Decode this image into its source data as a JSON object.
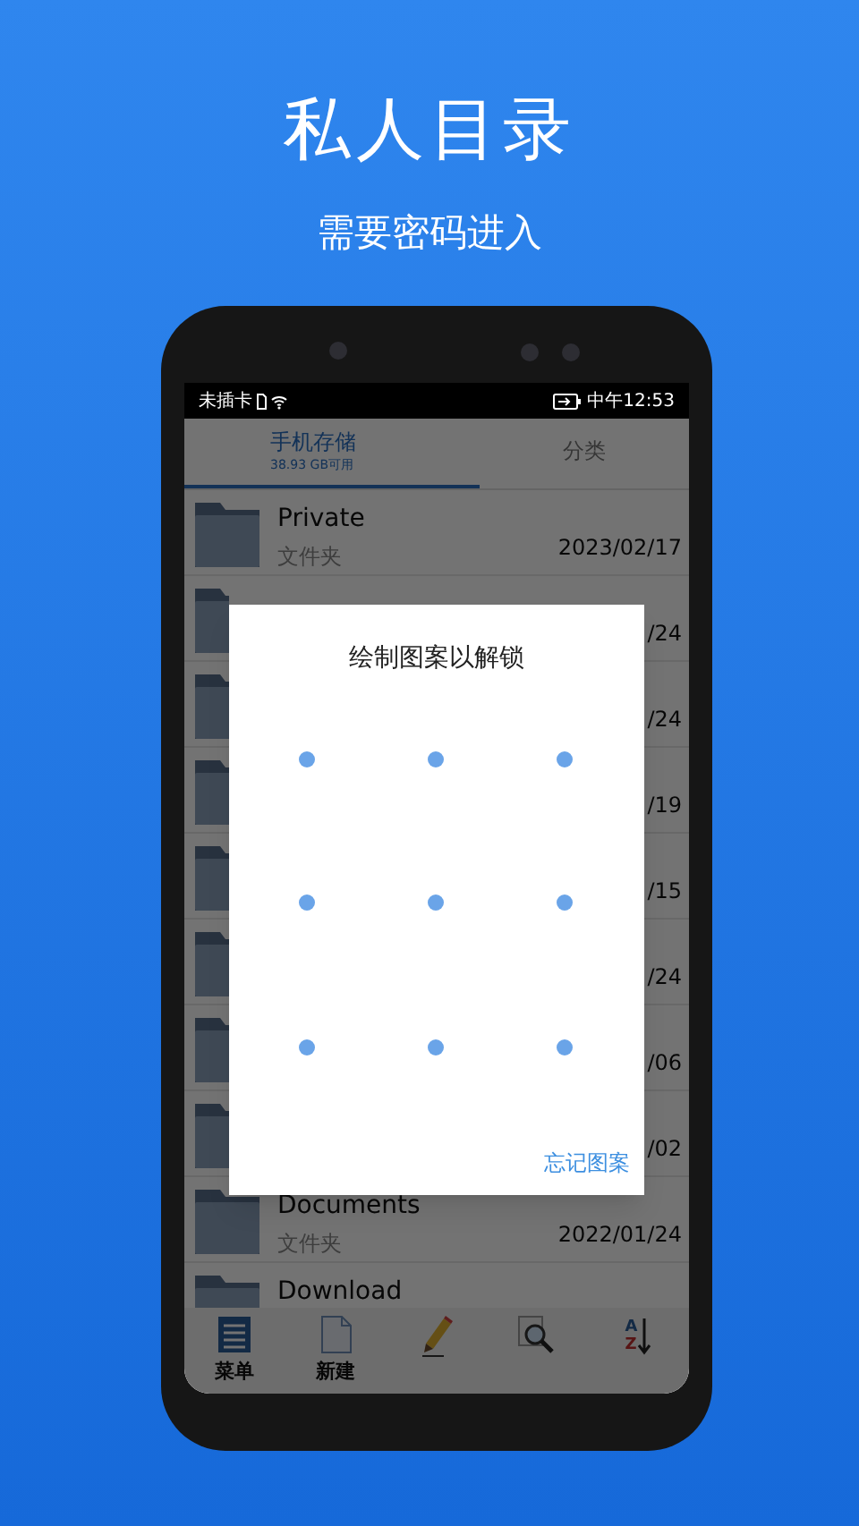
{
  "header": {
    "title": "私人目录",
    "subtitle": "需要密码进入"
  },
  "status_bar": {
    "carrier": "未插卡",
    "time": "中午12:53"
  },
  "tabs": [
    {
      "label": "手机存储",
      "sublabel": "38.93 GB可用",
      "selected": true
    },
    {
      "label": "分类",
      "selected": false
    }
  ],
  "files": [
    {
      "name": "Private",
      "type": "文件夹",
      "date": "2023/02/17"
    },
    {
      "date": "/24"
    },
    {
      "date": "/24"
    },
    {
      "date": "/19"
    },
    {
      "date": "/15"
    },
    {
      "date": "/24"
    },
    {
      "date": "/06"
    },
    {
      "date": "/02"
    },
    {
      "name": "Documents",
      "type": "文件夹",
      "date": "2022/01/24"
    },
    {
      "name": "Download"
    }
  ],
  "toolbar": [
    {
      "kind": "menu",
      "label": "菜单"
    },
    {
      "kind": "new",
      "label": "新建"
    },
    {
      "kind": "edit"
    },
    {
      "kind": "search"
    },
    {
      "kind": "sort",
      "glyphs": [
        "A",
        "Z"
      ]
    }
  ],
  "dialog": {
    "title": "绘制图案以解锁",
    "link": "忘记图案"
  }
}
